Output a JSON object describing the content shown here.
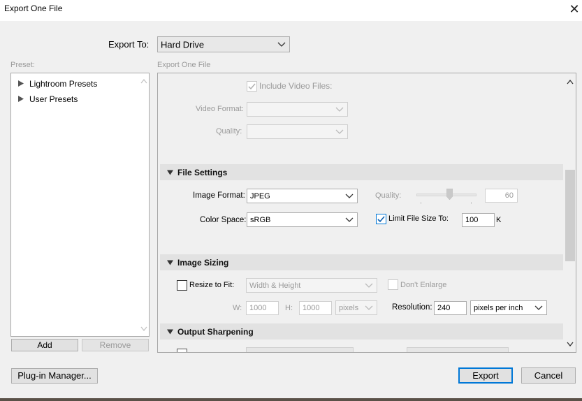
{
  "window": {
    "title": "Export One File",
    "close_icon": "close-icon"
  },
  "export_to": {
    "label": "Export To:",
    "value": "Hard Drive"
  },
  "preset": {
    "label": "Preset:",
    "items": [
      {
        "label": "Lightroom Presets"
      },
      {
        "label": "User Presets"
      }
    ],
    "add_label": "Add",
    "remove_label": "Remove"
  },
  "breadcrumb": "Export One File",
  "video": {
    "include_label": "Include Video Files:",
    "include_checked": true,
    "format_label": "Video Format:",
    "format_value": "",
    "quality_label": "Quality:",
    "quality_value": ""
  },
  "file_settings": {
    "title": "File Settings",
    "image_format_label": "Image Format:",
    "image_format_value": "JPEG",
    "quality_label": "Quality:",
    "quality_value": "60",
    "quality_fraction": 0.6,
    "color_space_label": "Color Space:",
    "color_space_value": "sRGB",
    "limit_label": "Limit File Size To:",
    "limit_checked": true,
    "limit_value": "100",
    "limit_unit": "K"
  },
  "image_sizing": {
    "title": "Image Sizing",
    "resize_label": "Resize to Fit:",
    "resize_checked": false,
    "resize_mode": "Width & Height",
    "dont_enlarge_label": "Don't Enlarge",
    "w_label": "W:",
    "w_value": "1000",
    "h_label": "H:",
    "h_value": "1000",
    "units": "pixels",
    "resolution_label": "Resolution:",
    "resolution_value": "240",
    "resolution_units": "pixels per inch"
  },
  "output_sharpening": {
    "title": "Output Sharpening"
  },
  "footer": {
    "plugin_manager_label": "Plug-in Manager...",
    "export_label": "Export",
    "cancel_label": "Cancel"
  },
  "colors": {
    "accent": "#0078d7",
    "section_bar": "#e2e2e2",
    "window_bg": "#f0f0f0"
  }
}
